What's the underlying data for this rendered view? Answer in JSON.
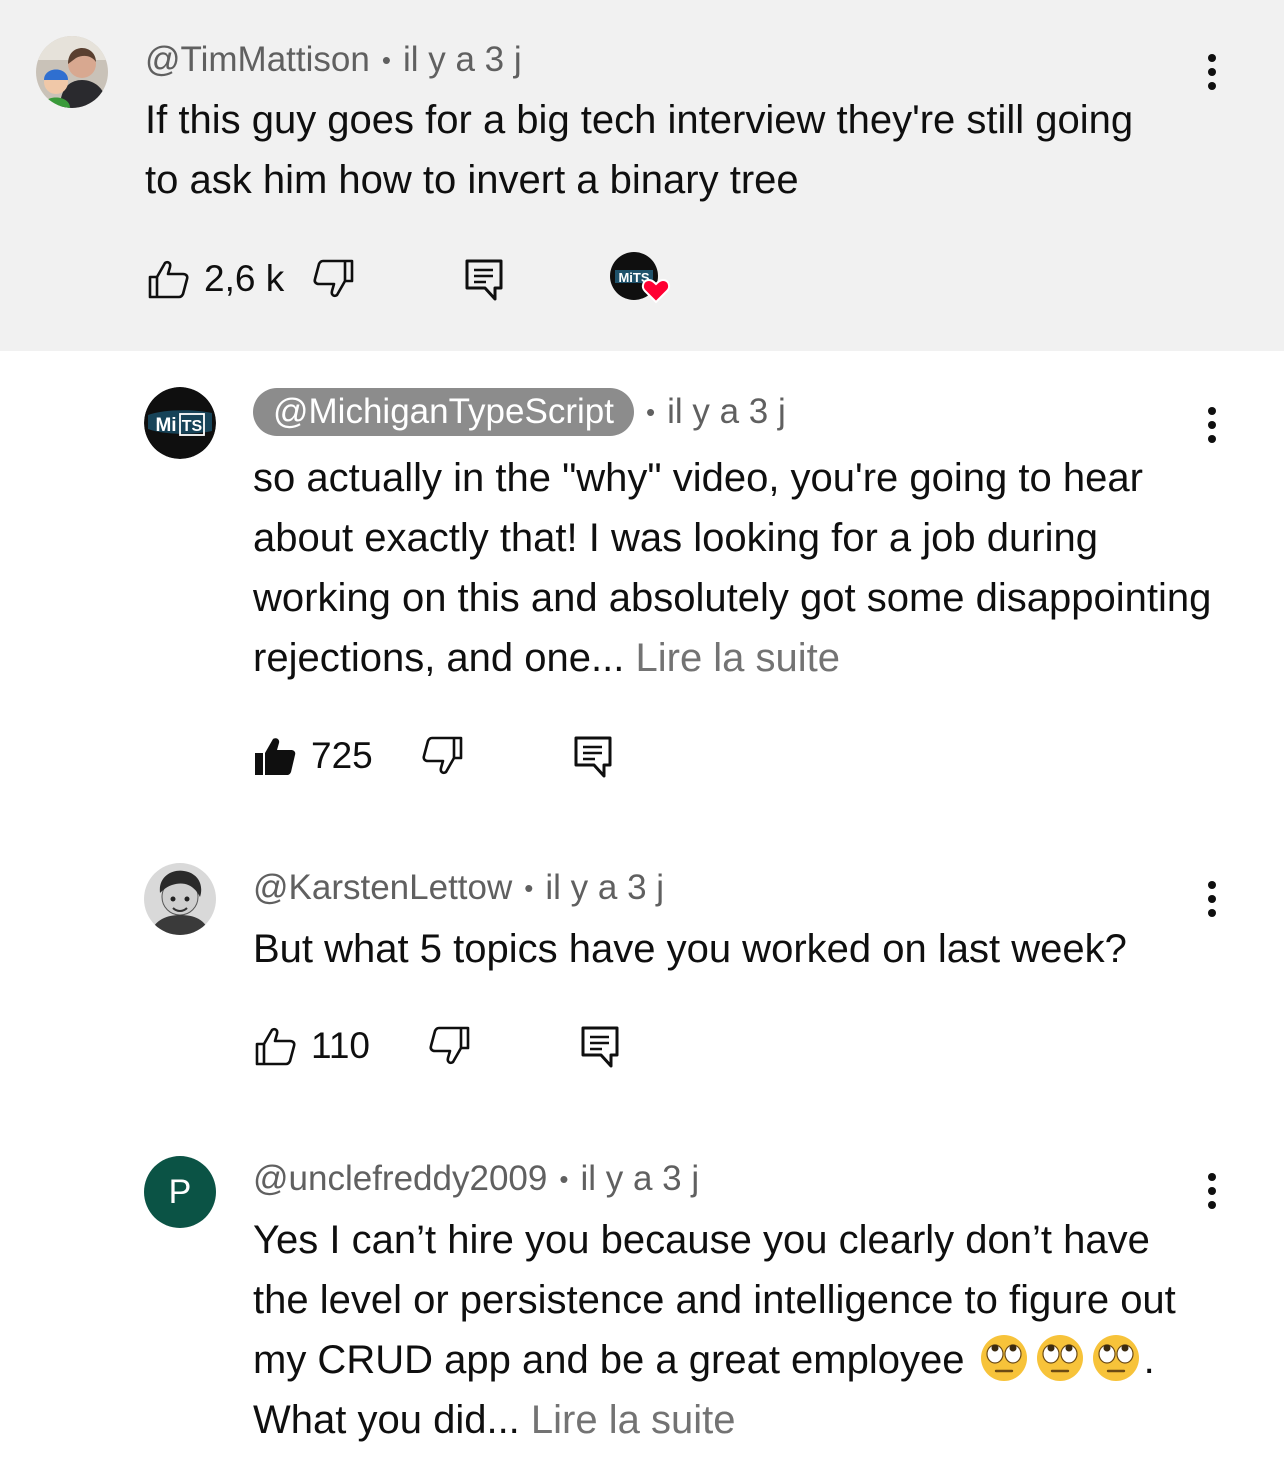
{
  "comments": [
    {
      "handle": "@TimMattison",
      "time": "il y a 3 j",
      "text": "If this guy goes for a big tech interview they're still going to ask him how to invert a binary tree",
      "likes": "2,6 k",
      "liked": false,
      "heart_badge_label": "MiTS"
    },
    {
      "handle": "@MichiganTypeScript",
      "avatar_label_a": "Mi",
      "avatar_label_b": "TS",
      "time": "il y a 3 j",
      "text": "so actually in the \"why\" video, you're going to hear about exactly that!  I was looking for a job during working on this and absolutely got some disappointing rejections, and one...",
      "read_more": "Lire la suite",
      "likes": "725",
      "liked": true
    },
    {
      "handle": "@KarstenLettow",
      "time": "il y a 3 j",
      "text": "But what 5 topics have you worked on last week?",
      "likes": "110",
      "liked": false
    },
    {
      "handle": "@unclefreddy2009",
      "avatar_letter": "P",
      "time": "il y a 3 j",
      "text_before": "Yes I can’t hire you because you clearly don’t have the level or persistence and intelligence to figure out my CRUD app and be a great employee",
      "emojis": [
        "face-with-rolling-eyes",
        "face-with-rolling-eyes",
        "face-with-rolling-eyes"
      ],
      "text_after": ". What you did...",
      "read_more": "Lire la suite"
    }
  ],
  "separator": "•",
  "colors": {
    "top_bg": "#f1f1f1",
    "secondary_text": "#606060",
    "pill_bg": "#8c8c8c",
    "avatar_green": "#0b5345",
    "heart": "#ff0033"
  }
}
